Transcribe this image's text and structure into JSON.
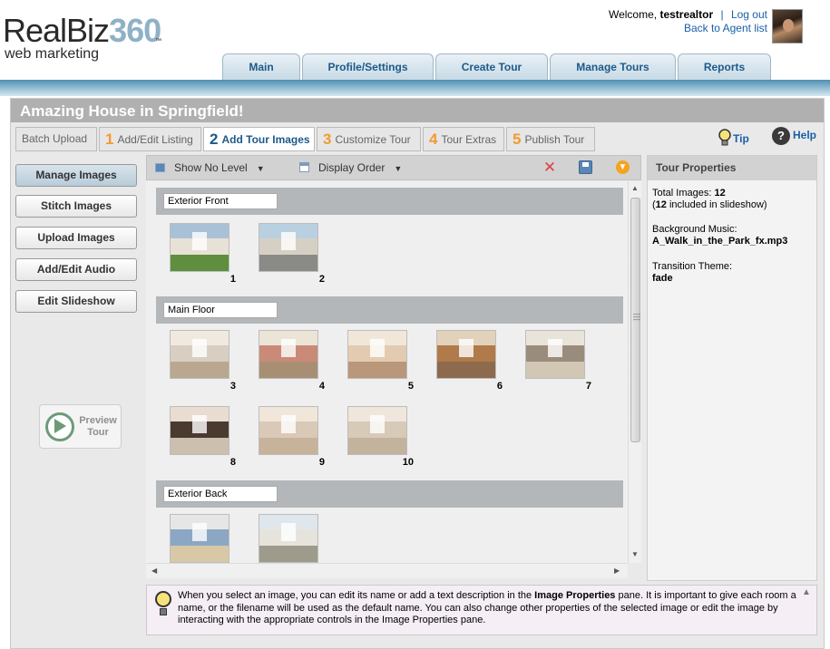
{
  "brand": {
    "name_part": "RealBiz",
    "name_num": "360",
    "tm": "™",
    "tagline": "web marketing"
  },
  "user": {
    "welcome": "Welcome,",
    "username": "testrealtor",
    "separator": "|",
    "logout": "Log out",
    "back_link": "Back to Agent list"
  },
  "nav": {
    "tabs": [
      "Main",
      "Profile/Settings",
      "Create Tour",
      "Manage Tours",
      "Reports"
    ]
  },
  "page": {
    "title": "Amazing House in Springfield!"
  },
  "steps": [
    {
      "num": "",
      "label": "Batch Upload"
    },
    {
      "num": "1",
      "label": "Add/Edit Listing"
    },
    {
      "num": "2",
      "label": "Add Tour Images"
    },
    {
      "num": "3",
      "label": "Customize Tour"
    },
    {
      "num": "4",
      "label": "Tour Extras"
    },
    {
      "num": "5",
      "label": "Publish Tour"
    }
  ],
  "active_step": 2,
  "tip_label": "Tip",
  "help_label": "Help",
  "sidebar": {
    "buttons": [
      "Manage Images",
      "Stitch Images",
      "Upload Images",
      "Add/Edit Audio",
      "Edit Slideshow"
    ],
    "active": "Manage Images",
    "preview_line1": "Preview",
    "preview_line2": "Tour"
  },
  "toolbar": {
    "level_filter": "Show No Level",
    "order": "Display Order"
  },
  "sections": [
    {
      "name": "Exterior Front",
      "images": [
        {
          "num": "1",
          "palette": [
            "#a9c1d6",
            "#e8e2d6",
            "#5f8e3e"
          ]
        },
        {
          "num": "2",
          "palette": [
            "#b9d0e0",
            "#d6d0c4",
            "#8a8a86"
          ]
        }
      ]
    },
    {
      "name": "Main Floor",
      "images": [
        {
          "num": "3",
          "palette": [
            "#efe9df",
            "#d8cfc2",
            "#b9a88f"
          ]
        },
        {
          "num": "4",
          "palette": [
            "#ece4d6",
            "#c98a77",
            "#a88f74"
          ]
        },
        {
          "num": "5",
          "palette": [
            "#f1e7d9",
            "#e2cbb0",
            "#b8977a"
          ]
        },
        {
          "num": "6",
          "palette": [
            "#e2d2bc",
            "#b07a4a",
            "#8d6a4d"
          ]
        },
        {
          "num": "7",
          "palette": [
            "#e9e4da",
            "#9a8c7c",
            "#d2c6b4"
          ]
        },
        {
          "num": "8",
          "palette": [
            "#e8ddd0",
            "#4a3a30",
            "#cdbfae"
          ]
        },
        {
          "num": "9",
          "palette": [
            "#f0e6da",
            "#d9c9b6",
            "#c7b29a"
          ]
        },
        {
          "num": "10",
          "palette": [
            "#efe7dc",
            "#d7cab8",
            "#c3b29c"
          ]
        }
      ]
    },
    {
      "name": "Exterior Back",
      "images": [
        {
          "num": "",
          "palette": [
            "#e6e6e6",
            "#8ba7c4",
            "#d9c8a6"
          ]
        },
        {
          "num": "",
          "palette": [
            "#dfe6ec",
            "#e6e3dc",
            "#9e9b8c"
          ]
        }
      ]
    }
  ],
  "properties": {
    "header": "Tour Properties",
    "total_label": "Total Images:",
    "total": "12",
    "included_pre": "(",
    "included": "12",
    "included_post": " included in slideshow)",
    "music_label": "Background Music:",
    "music": "A_Walk_in_the_Park_fx.mp3",
    "theme_label": "Transition Theme:",
    "theme": "fade"
  },
  "info": {
    "pre": "When you select an image, you can edit its name or add a text description in the ",
    "bold": "Image Properties",
    "post": " pane. It is important to give each room a name, or the filename will be used as the default name. You can also change other properties of the selected image or edit the image by interacting with the appropriate controls in the Image Properties pane."
  }
}
